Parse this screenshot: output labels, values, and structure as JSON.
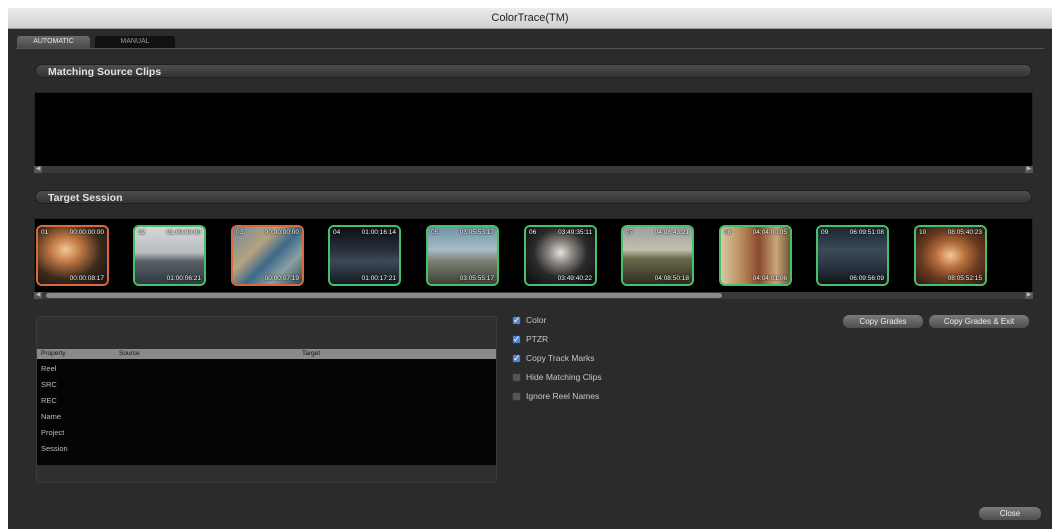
{
  "window": {
    "title": "ColorTrace(TM)"
  },
  "tabs": [
    {
      "label": "AUTOMATIC",
      "active": true
    },
    {
      "label": "MANUAL",
      "active": false
    }
  ],
  "matching_section": {
    "title": "Matching Source Clips"
  },
  "target_section": {
    "title": "Target Session"
  },
  "clips": [
    {
      "num": "01",
      "tc_in": "00:00:00:00",
      "tc_out": "00:00:08:17",
      "status": "unmatched",
      "border": "#d96b3a"
    },
    {
      "num": "02",
      "tc_in": "01:00:00:00",
      "tc_out": "01:00:06:21",
      "status": "matched",
      "border": "#45c268"
    },
    {
      "num": "03",
      "tc_in": "00:00:00:00",
      "tc_out": "00:00:07:19",
      "status": "unmatched",
      "border": "#d96b3a"
    },
    {
      "num": "04",
      "tc_in": "01:00:16:14",
      "tc_out": "01:00:17:21",
      "status": "matched",
      "border": "#45c268"
    },
    {
      "num": "05",
      "tc_in": "03:05:53:17",
      "tc_out": "03:05:55:17",
      "status": "matched",
      "border": "#45c268"
    },
    {
      "num": "06",
      "tc_in": "03:49:35:11",
      "tc_out": "03:49:40:22",
      "status": "matched",
      "border": "#45c268"
    },
    {
      "num": "07",
      "tc_in": "04:08:43:21",
      "tc_out": "04:08:50:18",
      "status": "matched",
      "border": "#45c268"
    },
    {
      "num": "08",
      "tc_in": "04:04:00:05",
      "tc_out": "04:04:01:06",
      "status": "matched",
      "border": "#45c268"
    },
    {
      "num": "09",
      "tc_in": "06:09:51:08",
      "tc_out": "06:09:56:09",
      "status": "matched",
      "border": "#45c268"
    },
    {
      "num": "10",
      "tc_in": "08:05:40:23",
      "tc_out": "08:05:52:15",
      "status": "matched",
      "border": "#45c268"
    }
  ],
  "properties": {
    "headers": [
      "Property",
      "Source",
      "Target"
    ],
    "rows": [
      "Reel",
      "SRC",
      "REC",
      "Name",
      "Project",
      "Session"
    ]
  },
  "options": [
    {
      "label": "Color",
      "checked": true
    },
    {
      "label": "PTZR",
      "checked": true
    },
    {
      "label": "Copy Track Marks",
      "checked": true
    },
    {
      "label": "Hide Matching Clips",
      "checked": false
    },
    {
      "label": "Ignore Reel Names",
      "checked": false
    }
  ],
  "buttons": {
    "copy_grades": "Copy Grades",
    "copy_grades_exit": "Copy Grades & Exit",
    "close": "Close"
  },
  "colors": {
    "matched": "#45c268",
    "unmatched": "#d96b3a",
    "checkbox": "#4d88d8"
  }
}
